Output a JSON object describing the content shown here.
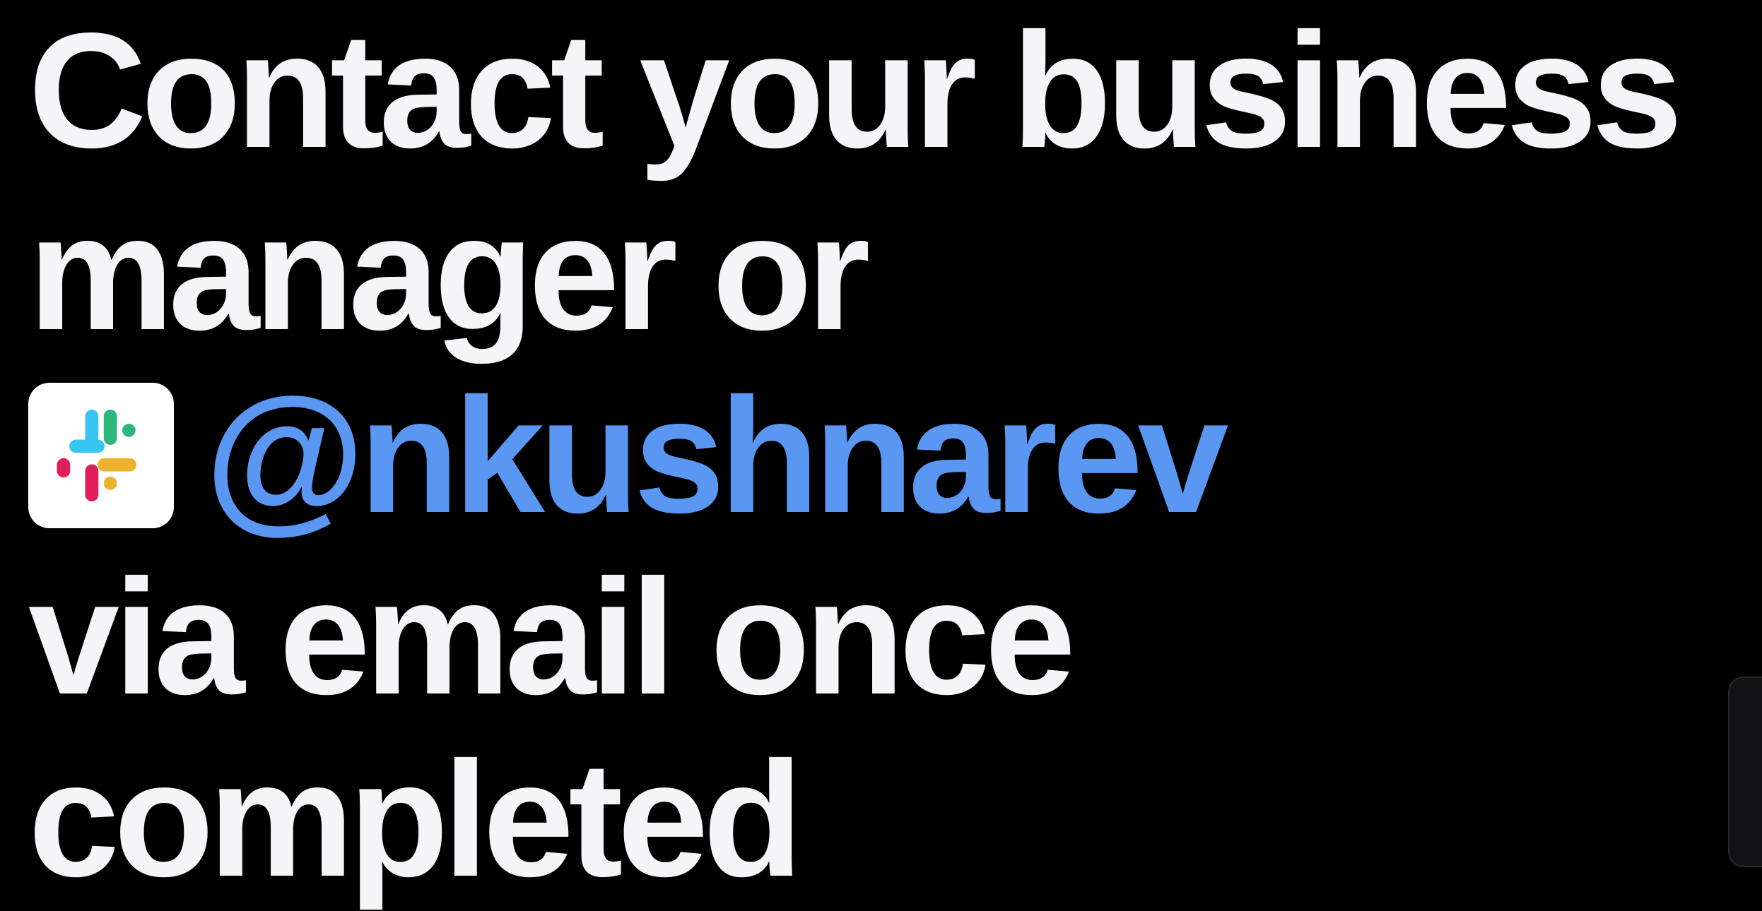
{
  "message": {
    "line1": "Contact your business",
    "line2": "manager or",
    "handle": "@nkushnarev",
    "line4": "via email once",
    "line5": "completed"
  },
  "slack_icon": {
    "name": "slack-icon",
    "colors": {
      "blue": "#36c5f0",
      "green": "#2eb67d",
      "yellow": "#ecb22e",
      "red": "#e01e5a"
    }
  },
  "colors": {
    "background": "#000000",
    "text": "#f5f5f7",
    "handle": "#5a97f2"
  }
}
